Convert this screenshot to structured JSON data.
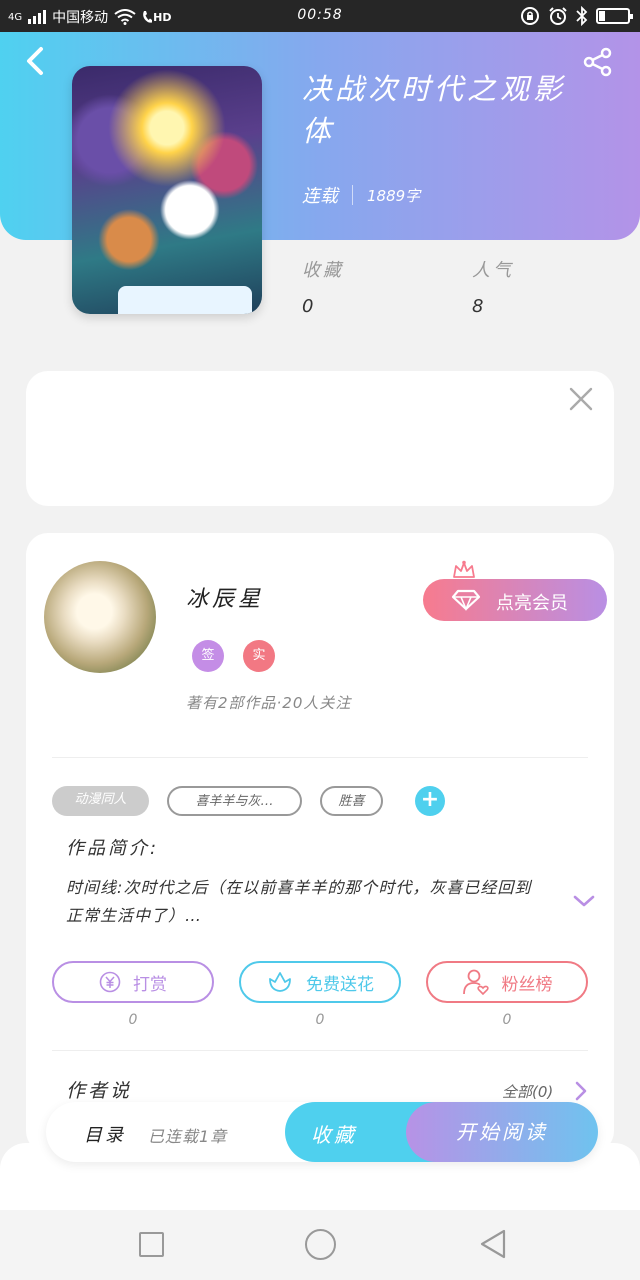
{
  "status_bar": {
    "network": "4G",
    "carrier": "中国移动",
    "hd": "HD",
    "time": "00:58",
    "battery_level": 0.2
  },
  "header": {
    "icons": {
      "back": "back-arrow-icon",
      "share": "share-icon"
    },
    "title": "决战次时代之观影体",
    "status": "连载",
    "word_count": "1889字",
    "stats": [
      {
        "label": "收藏",
        "value": "0"
      },
      {
        "label": "人气",
        "value": "8"
      }
    ]
  },
  "ad": {
    "close_icon": "close-icon"
  },
  "author": {
    "name": "冰辰星",
    "vip_button": "点亮会员",
    "badges": [
      {
        "label": "签",
        "color": "#c48de6"
      },
      {
        "label": "实",
        "color": "#f27883"
      }
    ],
    "works_info": "著有2部作品·20人关注"
  },
  "tags": [
    "动漫同人",
    "喜羊羊与灰…",
    "胜喜"
  ],
  "intro": {
    "heading": "作品简介:",
    "text": "时间线:次时代之后（在以前喜羊羊的那个时代，灰喜已经回到正常生活中了）…"
  },
  "actions": [
    {
      "label": "打赏",
      "count": "0",
      "color": "#b98fe4",
      "icon": "yuan-coin-icon"
    },
    {
      "label": "免费送花",
      "count": "0",
      "color": "#4fc9ea",
      "icon": "flower-icon"
    },
    {
      "label": "粉丝榜",
      "count": "0",
      "color": "#f07a84",
      "icon": "fan-user-icon"
    }
  ],
  "author_says": {
    "heading": "作者说",
    "all_label": "全部(0)"
  },
  "bottom_bar": {
    "catalog": "目录",
    "serial_status": "已连载1章",
    "favorite": "收藏",
    "start_reading": "开始阅读"
  }
}
